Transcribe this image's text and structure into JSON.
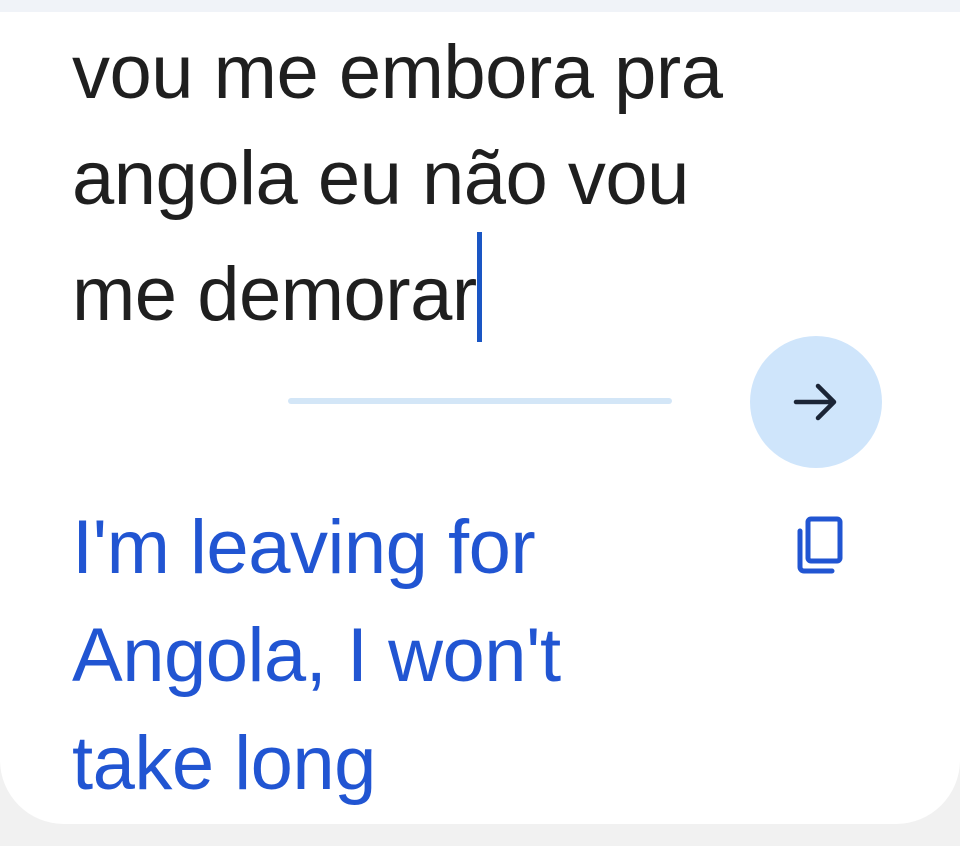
{
  "source": {
    "lines": [
      "vou me embora pra",
      "angola eu não vou",
      "me demorar"
    ],
    "language_hint": ""
  },
  "actions": {
    "translate_icon": "arrow-right-icon",
    "copy_icon": "copy-icon"
  },
  "translation": {
    "lines": [
      "I'm leaving for",
      "Angola, I won't",
      "take long"
    ]
  },
  "colors": {
    "source_text": "#1f1f1f",
    "translation_text": "#2155d2",
    "caret": "#1a56c4",
    "button_bg": "#cfe5fb",
    "divider": "#d3e6f7"
  }
}
